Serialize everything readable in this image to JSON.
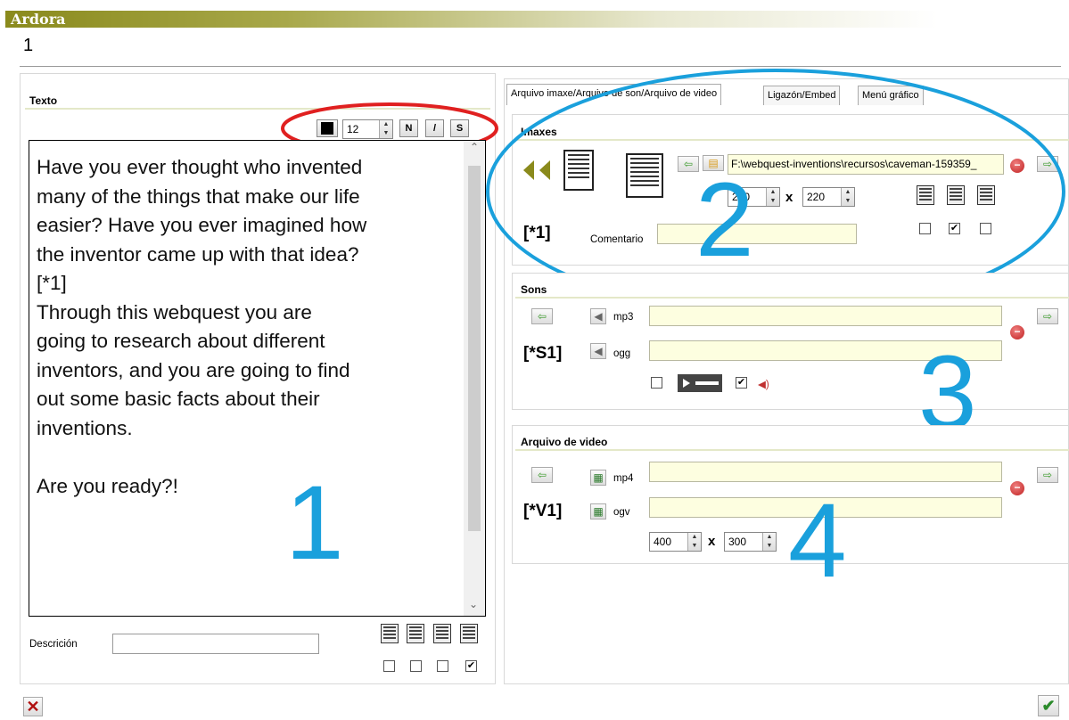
{
  "app": {
    "title": "Ardora",
    "page_number": "1"
  },
  "left": {
    "section_title": "Texto",
    "font_size": "12",
    "bold_label": "N",
    "italic_label": "/",
    "underline_label": "S",
    "text_lines": [
      "Have you ever thought who invented",
      "many of the things that make our life",
      "easier? Have you ever imagined how",
      "the inventor came up with that idea?",
      "[*1]",
      "Through this webquest you are",
      "going to research about different",
      "inventors, and you are going to find",
      "out some basic facts about their",
      "inventions.",
      "",
      "Are you ready?!"
    ],
    "description_label": "Descrición",
    "description_value": "",
    "align_checks": [
      false,
      false,
      false,
      true
    ],
    "annotation": "1"
  },
  "tabs": [
    "Arquivo imaxe/Arquivo de son/Arquivo de video",
    "Ligazón/Embed",
    "Menú gráfico"
  ],
  "images": {
    "section_title": "Imaxes",
    "file_path": "F:\\webquest-inventions\\recursos\\caveman-159359_",
    "width": "200",
    "height": "220",
    "times": "x",
    "ref": "[*1]",
    "comment_label": "Comentario",
    "comment_value": "",
    "position_checks": [
      false,
      true,
      false
    ],
    "annotation": "2"
  },
  "sounds": {
    "section_title": "Sons",
    "mp3_label": "mp3",
    "ogg_label": "ogg",
    "ref": "[*S1]",
    "autoplay_check": false,
    "controls_check": true,
    "annotation": "3"
  },
  "video": {
    "section_title": "Arquivo de video",
    "mp4_label": "mp4",
    "ogv_label": "ogv",
    "ref": "[*V1]",
    "width": "400",
    "height": "300",
    "times": "x",
    "annotation": "4"
  },
  "colors": {
    "annotation_blue": "#1aa0dc",
    "highlight_red": "#e02020",
    "input_bg": "#fdfee0"
  }
}
